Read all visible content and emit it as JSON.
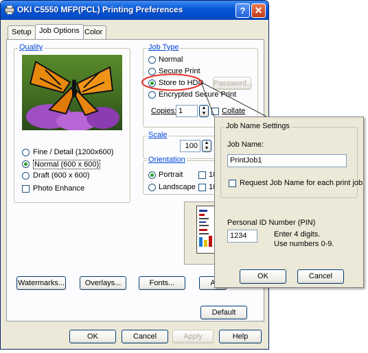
{
  "window": {
    "title": "OKI C5550 MFP(PCL) Printing Preferences",
    "help_button": "?",
    "close_button": "✕"
  },
  "tabs": [
    "Setup",
    "Job Options",
    "Color"
  ],
  "quality": {
    "label": "Quality",
    "options": [
      "Fine / Detail (1200x600)",
      "Normal (600 x 600)",
      "Draft (600 x 600)"
    ],
    "selected": 1,
    "photo_enhance": "Photo Enhance"
  },
  "job_type": {
    "label": "Job Type",
    "options": [
      "Normal",
      "Secure Print",
      "Store to HDD",
      "Encrypted Secure Print"
    ],
    "selected": 2,
    "password_button": "Password...",
    "copies_label": "Copies:",
    "copies_value": "1",
    "collate_label": "Collate"
  },
  "scale": {
    "label": "Scale",
    "value": "100"
  },
  "orientation": {
    "label": "Orientation",
    "options": [
      "Portrait",
      "Landscape"
    ],
    "selected": 0,
    "check1": "18",
    "check2": "18"
  },
  "buttons": {
    "watermarks": "Watermarks...",
    "overlays": "Overlays...",
    "fonts": "Fonts...",
    "advanced": "A",
    "default": "Default",
    "ok": "OK",
    "cancel": "Cancel",
    "apply": "Apply",
    "help": "Help"
  },
  "job_name_dialog": {
    "group_label": "Job Name Settings",
    "job_name_label": "Job Name:",
    "job_name_value": "PrintJob1",
    "request_label": "Request Job Name for each print job",
    "pin_label": "Personal ID Number (PIN)",
    "pin_value": "1234",
    "hint_line1": "Enter 4 digits.",
    "hint_line2": "Use numbers 0-9.",
    "ok": "OK",
    "cancel": "Cancel"
  },
  "colors": {
    "title_bar": "#0a5ad7",
    "highlight_ellipse": "#e8322c",
    "radio_dot": "#21a121",
    "group_label": "#0046d5"
  }
}
